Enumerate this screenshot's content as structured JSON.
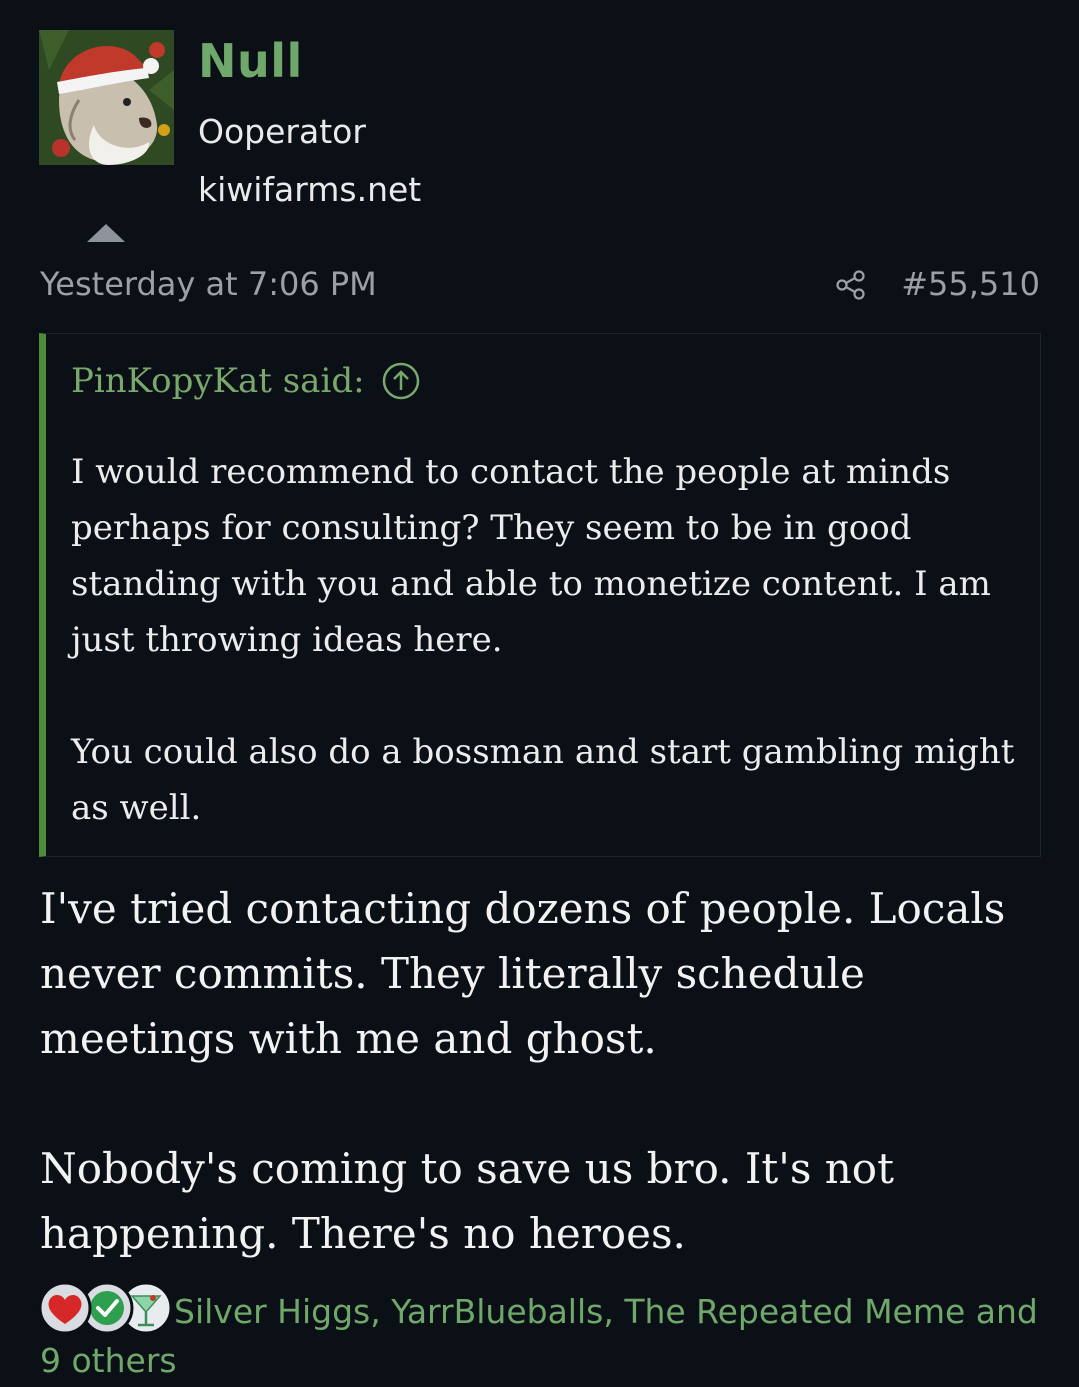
{
  "author": {
    "name": "Null",
    "title": "Ooperator",
    "site": "kiwifarms.net",
    "avatar_icon": "santa-hat-dog-avatar"
  },
  "post": {
    "timestamp": "Yesterday at 7:06 PM",
    "number": "#55,510",
    "share_icon": "share-icon"
  },
  "quote": {
    "author_line": "PinKopyKat said:",
    "jump_icon": "arrow-up-circle-icon",
    "paragraphs": [
      "I would recommend to contact the people at minds perhaps for consulting? They seem to be in good standing with you and able to monetize content. I am just throwing ideas here.",
      "You could also do a bossman and start gambling might as well."
    ]
  },
  "message": {
    "paragraphs": [
      "I've tried contacting dozens of people. Locals never commits. They literally schedule meetings with me and ghost.",
      "Nobody's coming to save us bro. It's not happening. There's no heroes."
    ]
  },
  "reactions": {
    "icons": [
      "heart-icon",
      "checkmark-icon",
      "cocktail-icon"
    ],
    "text": "Silver Higgs, YarrBlueballs, The Repeated Meme and 9 others"
  },
  "colors": {
    "background": "#0b0f16",
    "username": "#6fa86a",
    "quote_bar": "#4e8b36",
    "meta_text": "#9aa0a6"
  }
}
